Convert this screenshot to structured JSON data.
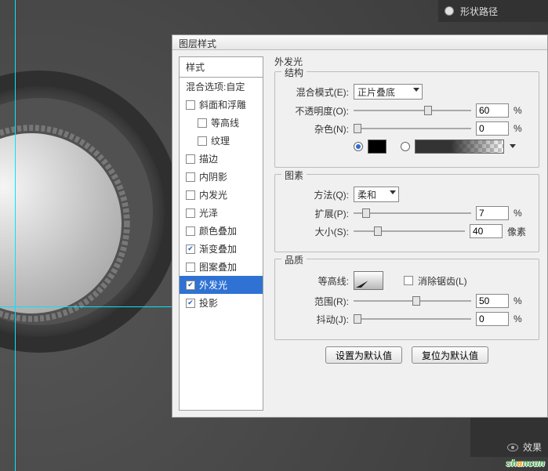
{
  "topbar": {
    "label": "形状路径"
  },
  "dialog": {
    "title": "图层样式"
  },
  "style_list": {
    "header": "样式",
    "blend_opts": "混合选项:自定",
    "items": [
      {
        "label": "斜面和浮雕",
        "checked": false,
        "indent": 0
      },
      {
        "label": "等高线",
        "checked": false,
        "indent": 1
      },
      {
        "label": "纹理",
        "checked": false,
        "indent": 1
      },
      {
        "label": "描边",
        "checked": false,
        "indent": 0
      },
      {
        "label": "内阴影",
        "checked": false,
        "indent": 0
      },
      {
        "label": "内发光",
        "checked": false,
        "indent": 0
      },
      {
        "label": "光泽",
        "checked": false,
        "indent": 0
      },
      {
        "label": "颜色叠加",
        "checked": false,
        "indent": 0
      },
      {
        "label": "渐变叠加",
        "checked": true,
        "indent": 0
      },
      {
        "label": "图案叠加",
        "checked": false,
        "indent": 0
      },
      {
        "label": "外发光",
        "checked": true,
        "indent": 0,
        "selected": true
      },
      {
        "label": "投影",
        "checked": true,
        "indent": 0
      }
    ]
  },
  "panel": {
    "title": "外发光",
    "structure": {
      "group": "结构",
      "blend_mode_label": "混合模式(E):",
      "blend_mode_value": "正片叠底",
      "opacity_label": "不透明度(O):",
      "opacity_value": "60",
      "opacity_unit": "%",
      "noise_label": "杂色(N):",
      "noise_value": "0",
      "noise_unit": "%",
      "color_swatch": "#000000"
    },
    "elements": {
      "group": "图素",
      "technique_label": "方法(Q):",
      "technique_value": "柔和",
      "spread_label": "扩展(P):",
      "spread_value": "7",
      "spread_unit": "%",
      "size_label": "大小(S):",
      "size_value": "40",
      "size_unit": "像素"
    },
    "quality": {
      "group": "品质",
      "contour_label": "等高线:",
      "antialias_label": "消除锯齿(L)",
      "range_label": "范围(R):",
      "range_value": "50",
      "range_unit": "%",
      "jitter_label": "抖动(J):",
      "jitter_value": "0",
      "jitter_unit": "%"
    },
    "buttons": {
      "make_default": "设置为默认值",
      "reset_default": "复位为默认值"
    }
  },
  "bottombar": {
    "fx_label": "效果"
  },
  "watermark": {
    "a": "sh",
    "b": "a",
    "c": "ncun"
  }
}
